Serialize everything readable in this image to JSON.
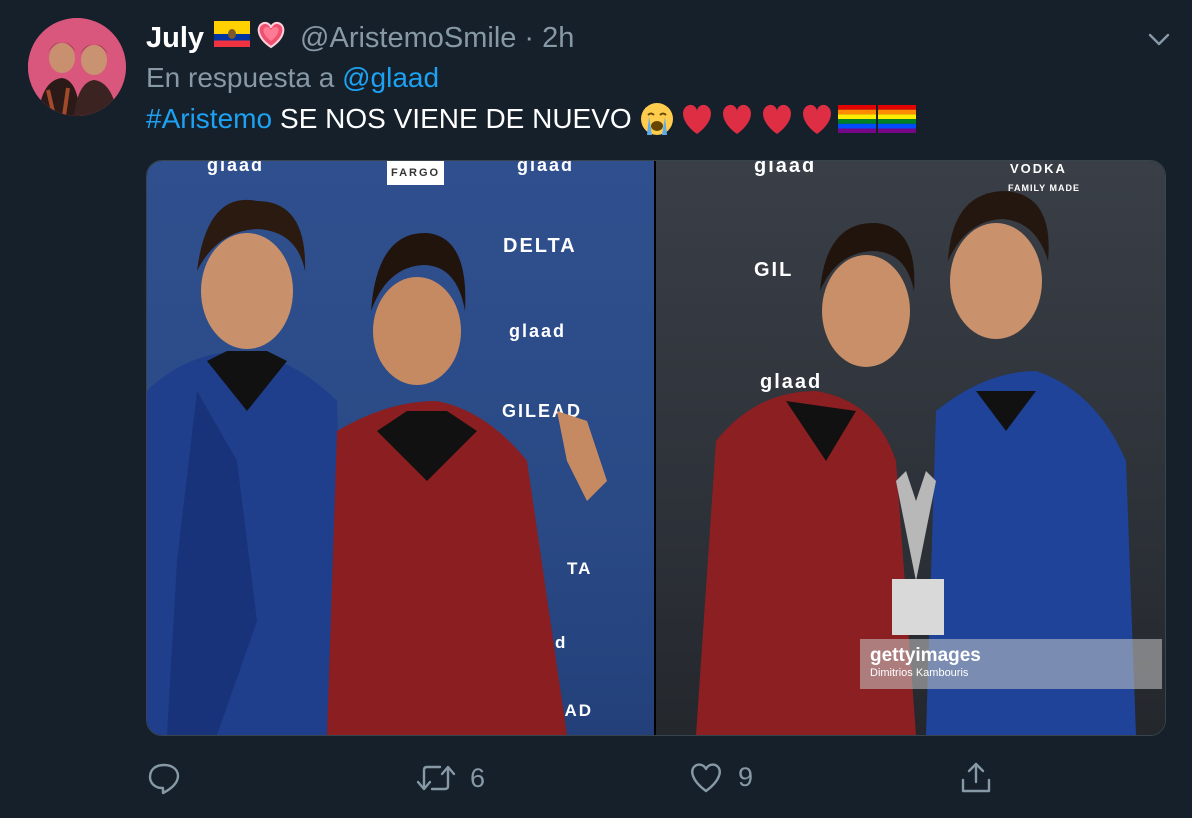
{
  "tweet": {
    "display_name": "July",
    "handle": "@AristemoSmile",
    "separator": "·",
    "time": "2h",
    "reply_prefix": "En respuesta a",
    "reply_mention": "@glaad",
    "hashtag": "#Aristemo",
    "text": "SE NOS VIENE DE NUEVO",
    "emojis": [
      "crying-face",
      "red-heart",
      "red-heart",
      "red-heart",
      "red-heart",
      "rainbow-flag",
      "rainbow-flag"
    ],
    "header_emojis": [
      "ecuador-flag",
      "sparkling-heart"
    ]
  },
  "media": {
    "left_wall": {
      "brand1": "glaad",
      "brand2": "DELTA",
      "brand3": "GILEAD",
      "brand4": "FARGO",
      "brand5": "ILEAD",
      "brand6": "TA"
    },
    "right_wall": {
      "brand1": "glaad",
      "brand2": "VODKA",
      "brand3": "FAMILY MADE",
      "brand4": "GIL"
    },
    "watermark_brand": "gettyimages",
    "watermark_credit": "Dimitrios Kambouris"
  },
  "actions": {
    "reply_count": "",
    "retweet_count": "6",
    "like_count": "9",
    "share_label": ""
  },
  "colors": {
    "background": "#15202b",
    "link": "#1da1f2",
    "secondary": "#8899a6"
  }
}
